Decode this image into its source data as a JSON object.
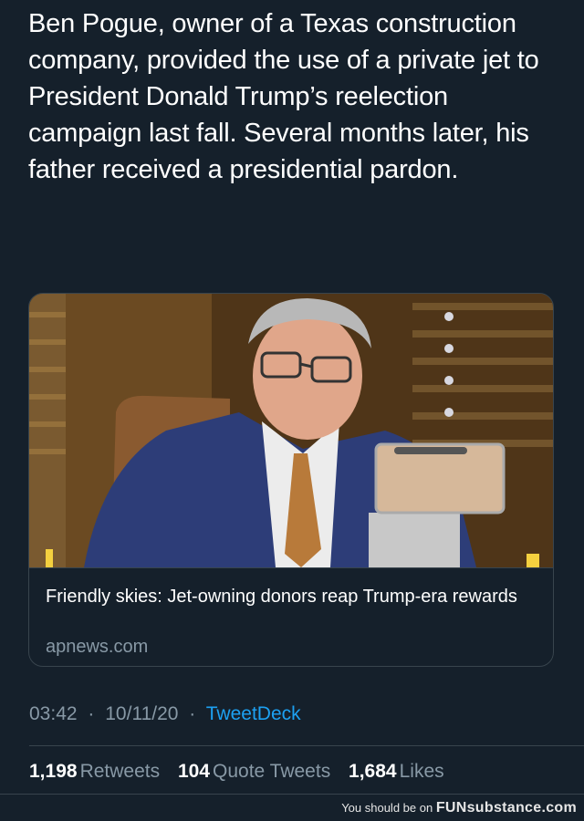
{
  "tweet": {
    "text": "Ben Pogue, owner of a Texas construction company, provided the use of a private jet to President Donald Trump’s reelection campaign last fall. Several months later, his father received a presidential pardon."
  },
  "card": {
    "title": "Friendly skies: Jet-owning donors reap Trump-era rewards",
    "domain": "apnews.com"
  },
  "meta": {
    "time": "03:42",
    "separator": "·",
    "date": "10/11/20",
    "source": "TweetDeck"
  },
  "stats": {
    "retweets_count": "1,198",
    "retweets_label": "Retweets",
    "quotes_count": "104",
    "quotes_label": "Quote Tweets",
    "likes_count": "1,684",
    "likes_label": "Likes"
  },
  "watermark": {
    "prefix": "You should be on",
    "brand": "FUNsubstance.com"
  },
  "colors": {
    "background": "#15202b",
    "text": "#ffffff",
    "secondary": "#8899a6",
    "link": "#1da1f2",
    "border": "#38444d"
  }
}
